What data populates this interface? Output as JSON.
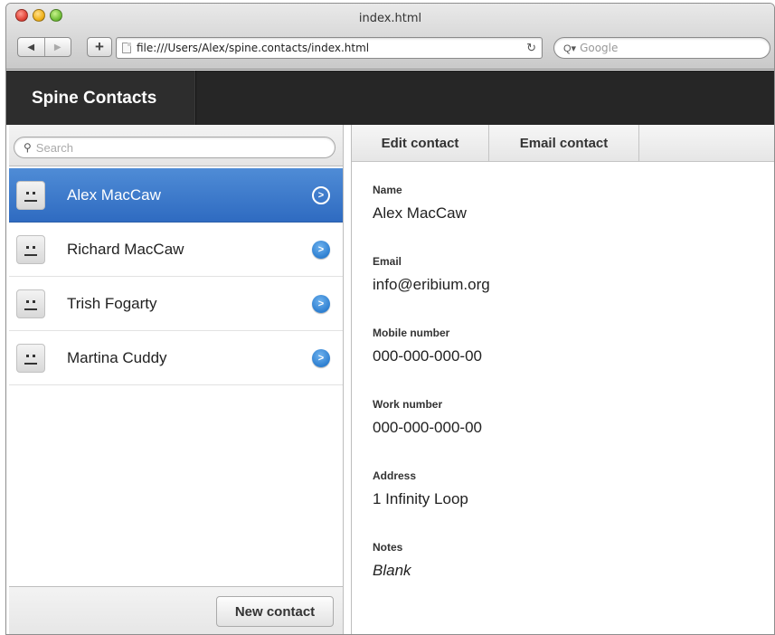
{
  "window": {
    "title": "index.html",
    "url": "file:///Users/Alex/spine.contacts/index.html",
    "search_placeholder": "Google",
    "nav": {
      "back": "◀",
      "forward": "▶",
      "add": "+",
      "reload": "↻",
      "magnifier": "Q▾"
    }
  },
  "app": {
    "title": "Spine Contacts"
  },
  "sidebar": {
    "search_placeholder": "Search",
    "contacts": [
      {
        "name": "Alex MacCaw",
        "selected": true
      },
      {
        "name": "Richard MacCaw",
        "selected": false
      },
      {
        "name": "Trish Fogarty",
        "selected": false
      },
      {
        "name": "Martina Cuddy",
        "selected": false
      }
    ],
    "new_contact_label": "New contact"
  },
  "toolbar": {
    "edit_label": "Edit contact",
    "email_label": "Email contact"
  },
  "details": [
    {
      "label": "Name",
      "value": "Alex MacCaw",
      "italic": false
    },
    {
      "label": "Email",
      "value": "info@eribium.org",
      "italic": false
    },
    {
      "label": "Mobile number",
      "value": "000-000-000-00",
      "italic": false
    },
    {
      "label": "Work number",
      "value": "000-000-000-00",
      "italic": false
    },
    {
      "label": "Address",
      "value": "1 Infinity Loop",
      "italic": false
    },
    {
      "label": "Notes",
      "value": "Blank",
      "italic": true
    }
  ],
  "icons": {
    "search": "magnifier-icon",
    "avatar": "robot-face-icon",
    "disclosure": "chevron-right-circle-icon"
  },
  "colors": {
    "selected_row": "#3a78c9",
    "header_bg": "#262626",
    "disclosure": "#2e7fd0"
  }
}
